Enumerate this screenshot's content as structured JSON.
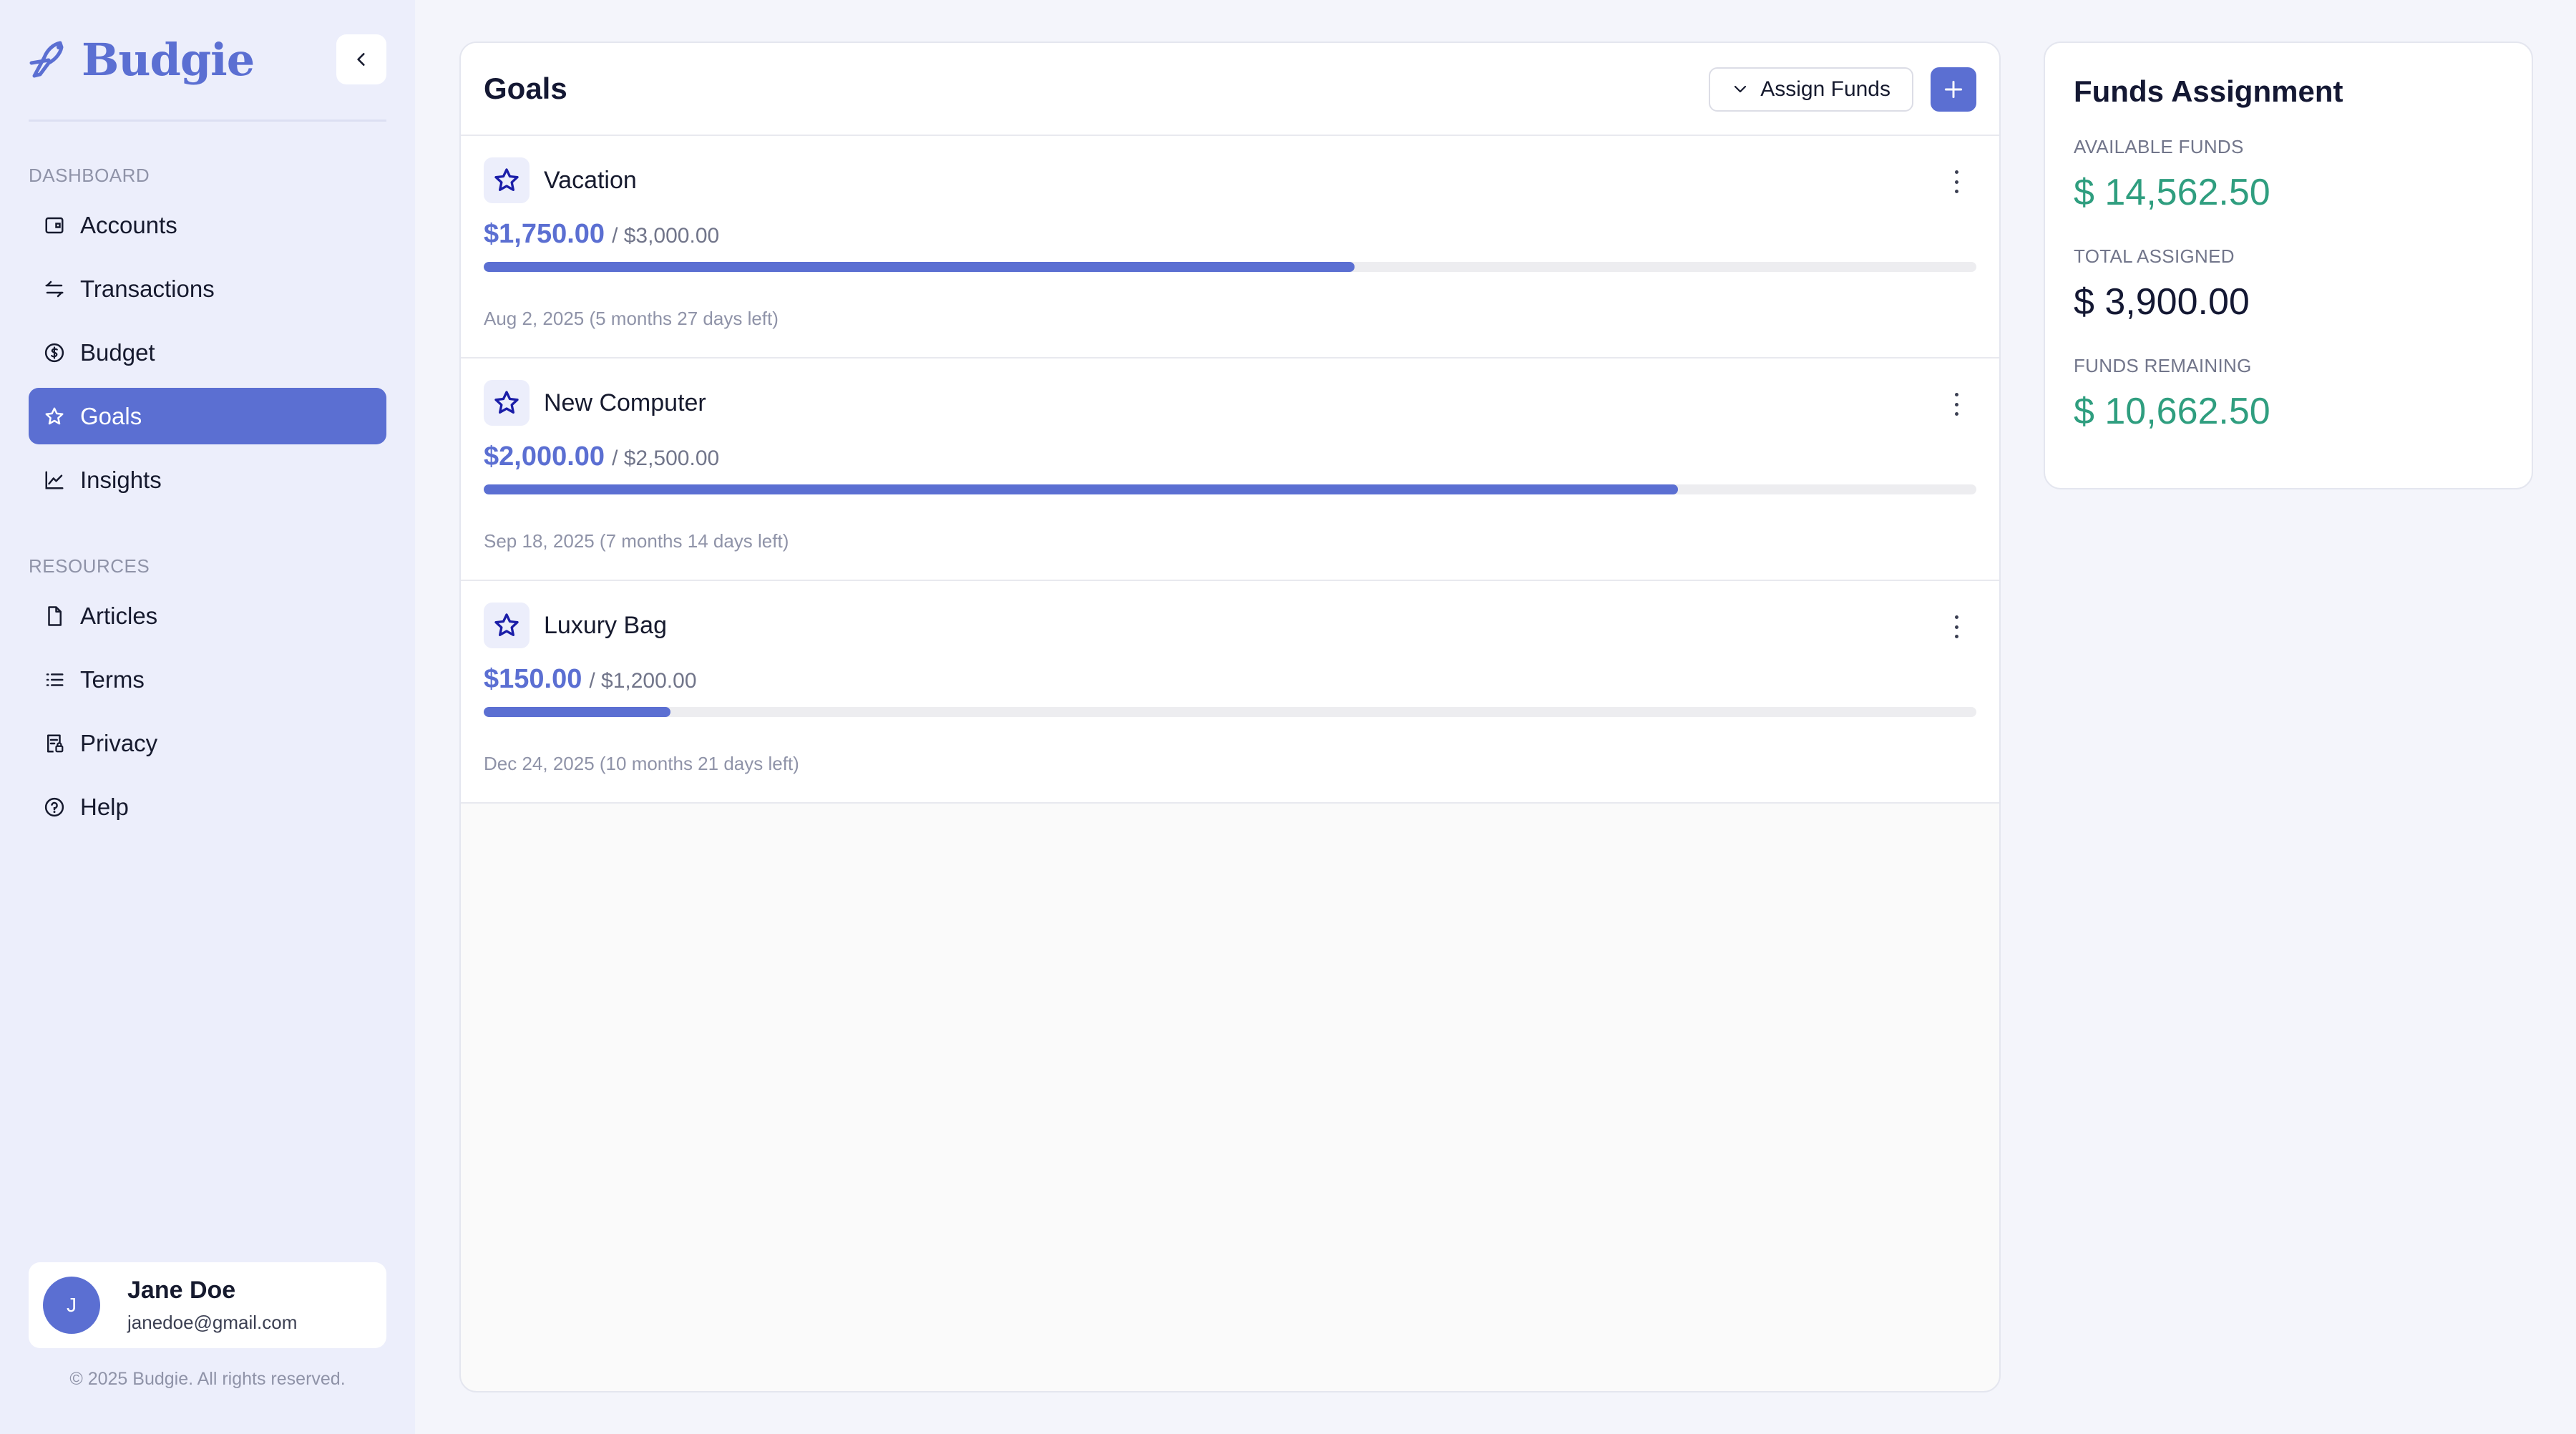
{
  "brand": {
    "name": "Budgie"
  },
  "sidebar": {
    "dashboard_label": "DASHBOARD",
    "dashboard_items": [
      {
        "label": "Accounts",
        "icon": "wallet-icon"
      },
      {
        "label": "Transactions",
        "icon": "arrows-icon"
      },
      {
        "label": "Budget",
        "icon": "dollar-circle-icon"
      },
      {
        "label": "Goals",
        "icon": "star-icon",
        "active": true
      },
      {
        "label": "Insights",
        "icon": "chart-line-icon"
      }
    ],
    "resources_label": "RESOURCES",
    "resources_items": [
      {
        "label": "Articles",
        "icon": "file-icon"
      },
      {
        "label": "Terms",
        "icon": "list-icon"
      },
      {
        "label": "Privacy",
        "icon": "document-lock-icon"
      },
      {
        "label": "Help",
        "icon": "help-circle-icon"
      }
    ]
  },
  "user": {
    "initial": "J",
    "name": "Jane Doe",
    "email": "janedoe@gmail.com"
  },
  "footer": {
    "copyright": "© 2025 Budgie. All rights reserved."
  },
  "goals": {
    "title": "Goals",
    "assign_label": "Assign Funds",
    "items": [
      {
        "name": "Vacation",
        "current": "$1,750.00",
        "target": "/ $3,000.00",
        "progress": 0.5833,
        "date": "Aug 2, 2025 (5 months 27 days left)"
      },
      {
        "name": "New Computer",
        "current": "$2,000.00",
        "target": "/ $2,500.00",
        "progress": 0.8,
        "date": "Sep 18, 2025 (7 months 14 days left)"
      },
      {
        "name": "Luxury Bag",
        "current": "$150.00",
        "target": "/ $1,200.00",
        "progress": 0.125,
        "date": "Dec 24, 2025 (10 months 21 days left)"
      }
    ]
  },
  "funds": {
    "title": "Funds Assignment",
    "available_label": "AVAILABLE FUNDS",
    "available_value": "$ 14,562.50",
    "assigned_label": "TOTAL ASSIGNED",
    "assigned_value": "$ 3,900.00",
    "remaining_label": "FUNDS REMAINING",
    "remaining_value": "$ 10,662.50"
  },
  "colors": {
    "accent": "#5b6fd2",
    "positive": "#2f9e7f",
    "sidebar_bg": "#eceefb"
  }
}
